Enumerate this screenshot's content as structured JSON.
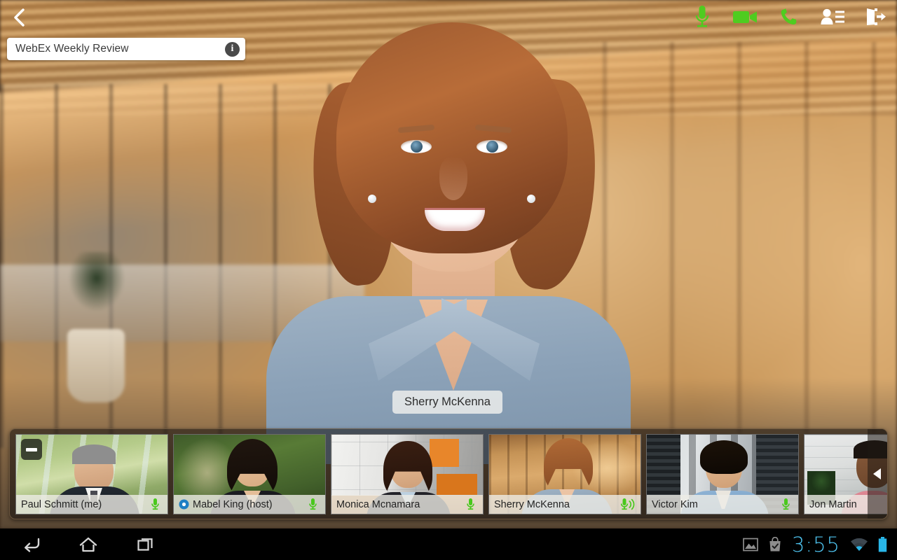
{
  "app": {
    "meeting_title": "WebEx Weekly Review",
    "active_speaker": "Sherry McKenna"
  },
  "topbar": {
    "back_label": "Back",
    "back_icon": "chevron-left-icon",
    "info_label": "i",
    "info_icon": "info-icon",
    "tools": [
      {
        "name": "microphone",
        "icon": "microphone-icon",
        "label": "Mute",
        "color": "#4fcc20",
        "state": "on"
      },
      {
        "name": "video",
        "icon": "video-camera-icon",
        "label": "Stop Video",
        "color": "#4fcc20",
        "state": "on"
      },
      {
        "name": "audio",
        "icon": "phone-icon",
        "label": "Audio",
        "color": "#4fcc20",
        "state": "on"
      },
      {
        "name": "participants",
        "icon": "participants-icon",
        "label": "Participants",
        "color": "#ffffff",
        "state": "off"
      },
      {
        "name": "leave",
        "icon": "exit-icon",
        "label": "Leave Meeting",
        "color": "#ffffff",
        "state": "off"
      }
    ]
  },
  "filmstrip": {
    "collapse_icon": "triangle-left-icon",
    "collapse_label": "Collapse filmstrip",
    "self_minimize_icon": "minimize-icon",
    "mic_icon": "microphone-icon",
    "speaking_icon": "microphone-speaking-icon",
    "host_icon": "webex-host-icon",
    "participants": [
      {
        "name": "Paul Schmitt (me)",
        "is_self": true,
        "is_host": false,
        "mic": "on",
        "speaking": false
      },
      {
        "name": "Mabel King (host)",
        "is_self": false,
        "is_host": true,
        "mic": "on",
        "speaking": false
      },
      {
        "name": "Monica Mcnamara",
        "is_self": false,
        "is_host": false,
        "mic": "on",
        "speaking": false
      },
      {
        "name": "Sherry McKenna",
        "is_self": false,
        "is_host": false,
        "mic": "on",
        "speaking": true
      },
      {
        "name": "Victor Kim",
        "is_self": false,
        "is_host": false,
        "mic": "on",
        "speaking": false
      },
      {
        "name": "Jon Martin",
        "is_self": false,
        "is_host": false,
        "mic": "none",
        "speaking": false
      }
    ]
  },
  "navbar": {
    "buttons": [
      {
        "name": "back",
        "icon": "back-arrow-icon",
        "label": "Back"
      },
      {
        "name": "home",
        "icon": "home-icon",
        "label": "Home"
      },
      {
        "name": "recent",
        "icon": "recent-apps-icon",
        "label": "Recent Apps"
      }
    ],
    "tray": [
      {
        "name": "screenshot",
        "icon": "image-icon",
        "label": "Screenshot captured"
      },
      {
        "name": "play-store",
        "icon": "shopping-bag-check-icon",
        "label": "Play Store"
      }
    ],
    "clock": "3:55",
    "wifi_icon": "wifi-icon",
    "wifi_label": "Wi-Fi connected",
    "battery_icon": "battery-full-icon",
    "battery_label": "Battery full"
  },
  "colors": {
    "accent_green": "#4fcc20",
    "clock_blue": "#4ec3ef",
    "chip_bg": "#ffffff",
    "navbar_bg": "#000000"
  }
}
